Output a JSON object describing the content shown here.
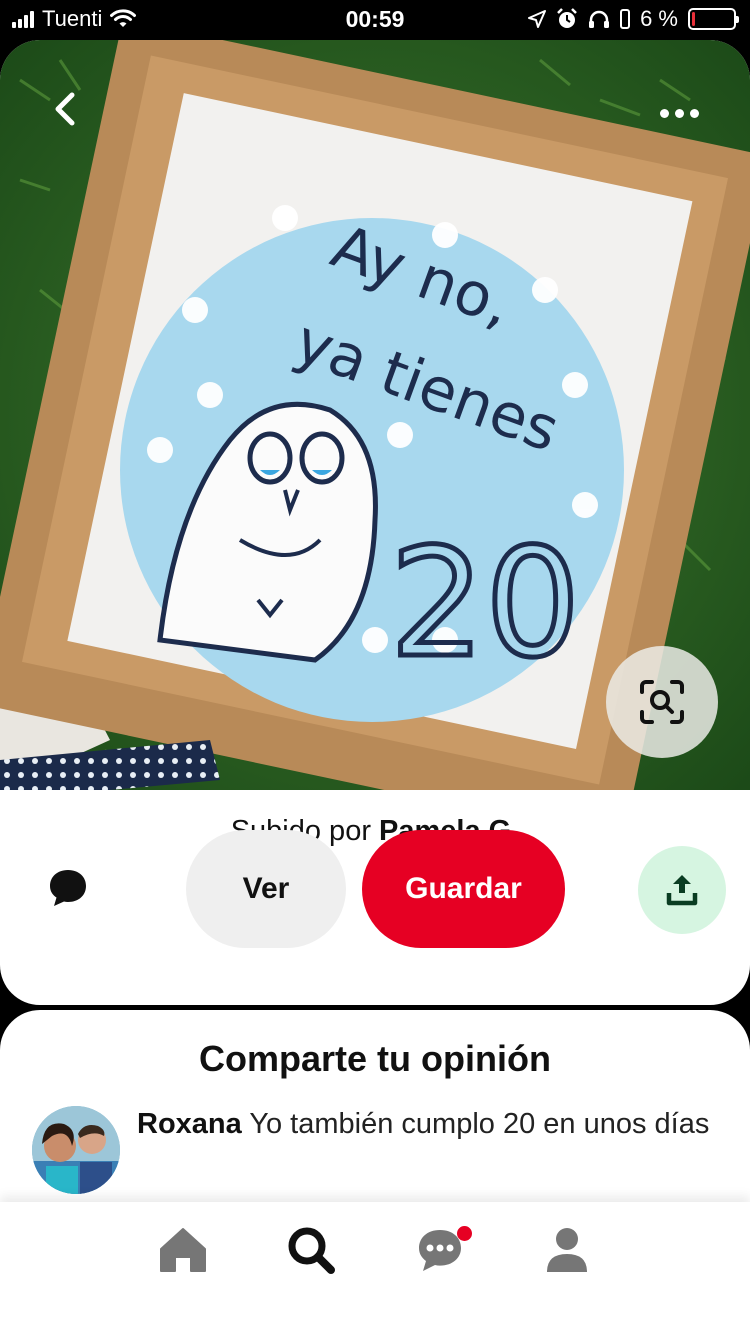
{
  "status_bar": {
    "carrier": "Tuenti",
    "time": "00:59",
    "battery": "6 %",
    "battery_level": 0.06
  },
  "pin": {
    "image_alt": "Ay no, ya tienes 20",
    "cake_text_line1": "Ay no,",
    "cake_text_line2": "ya tienes",
    "cake_text_number": "20"
  },
  "uploader": {
    "prefix": "Subido por",
    "name": "Pamela G."
  },
  "actions": {
    "ver_label": "Ver",
    "save_label": "Guardar"
  },
  "comments": {
    "title": "Comparte tu opinión",
    "items": [
      {
        "author": "Roxana",
        "text": "Yo también cumplo 20 en unos días"
      }
    ]
  },
  "colors": {
    "accent": "#e60023",
    "share_bg": "#d6f5e1",
    "share_icon": "#0a6b3b"
  },
  "icons": {
    "back": "chevron-left-icon",
    "more": "more-horizontal-icon",
    "lens": "visual-search-icon",
    "comment": "speech-bubble-icon",
    "share": "share-upload-icon",
    "nav": [
      "home-icon",
      "search-icon",
      "messages-icon",
      "profile-icon"
    ]
  }
}
